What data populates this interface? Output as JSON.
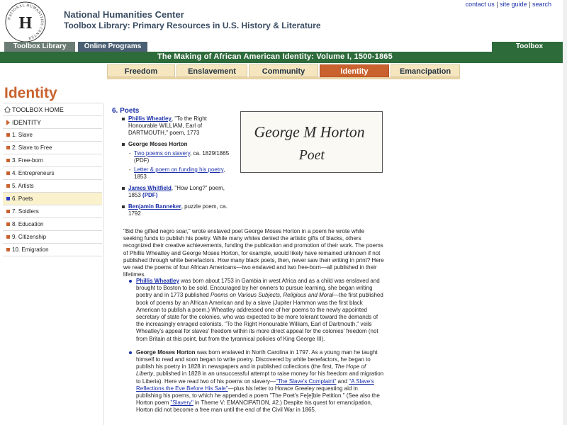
{
  "header": {
    "org_name": "National Humanities Center",
    "library_name": "Toolbox Library: Primary Resources in U.S. History & Literature",
    "logo_text": "NATIONAL HUMANITIES CENTER",
    "logo_letter": "H",
    "links": [
      "contact us",
      "site guide",
      "search"
    ],
    "link_sep": "|"
  },
  "nav": {
    "tab_toolbox_library": "Toolbox Library",
    "tab_online_programs": "Online Programs",
    "tab_toolbox": "Toolbox",
    "banner_title": "The Making of African American Identity: Volume I, 1500-1865",
    "theme_tabs": [
      "Freedom",
      "Enslavement",
      "Community",
      "Identity",
      "Emancipation"
    ],
    "active_theme": "Identity"
  },
  "page_title": "Identity",
  "sidebar": {
    "home": "TOOLBOX HOME",
    "current": "IDENTITY",
    "items": [
      "1. Slave",
      "2. Slave to Free",
      "3. Free-born",
      "4. Entrepreneurs",
      "5. Artists",
      "6. Poets",
      "7. Soldiers",
      "8. Education",
      "9. Citizenship",
      "10. Emigration"
    ],
    "active_item": "6. Poets"
  },
  "section": {
    "heading": "6.  Poets",
    "r1_link": "Phillis Wheatley",
    "r1_text": ", \"To the Right Honourable WILLIAM, Earl of DARTMOUTH,\" poem, 1773",
    "r2_name": "George Moses Horton",
    "r2_sub1_link": "Two poems on slavery",
    "r2_sub1_text": ", ca. 1829/1865",
    "r2_sub2_link": "Letter & poem on funding his poetry",
    "r2_sub2_text": ", 1853",
    "pdf": "(PDF)",
    "r3_link": "James Whitfield",
    "r3_text": ", \"How Long?\" poem, 1853",
    "r4_link": "Benjamin Banneker",
    "r4_text": ", puzzle poem, ca. 1792",
    "signature_line1": "George M Horton",
    "signature_line2": "Poet"
  },
  "intro": "\"Bid the gifted negro soar,\" wrote enslaved poet George Moses Horton in a poem he wrote while seeking funds to publish his poetry. While many whites denied the artistic gifts of blacks, others recognized their creative achievements, funding the publication and promotion of their work. The poems of Phillis Wheatley and George Moses Horton, for example, would likely have remained unknown if not published through white benefactors. How many black poets, then, never saw their writing in print? Here we read the poems of four African Americans—two enslaved and two free-born—all published in their lifetimes.",
  "bios": {
    "wheatley_name": "Phillis Wheatley",
    "wheatley_a": " was born about 1753 in Gambia in west Africa and as a child was enslaved and brought to Boston to be sold. Encouraged by her owners to pursue learning, she began writing poetry and in 1773 published ",
    "wheatley_book": "Poems on Various Subjects, Religious and Moral",
    "wheatley_b": "—the first published book of poems by an African American and by a slave (Jupiter Hammon was the first black American to publish a poem.) Wheatley addressed one of her poems to the newly appointed secretary of state for the colonies, who was expected to be more tolerant toward the demands of the increasingly enraged colonists. \"To the Right Honourable William, Earl of Dartmouth,\" veils Wheatley's appeal for slaves' freedom within its more direct appeal for the colonies' freedom (not from Britain at this point, but from the tyrannical policies of King George III).",
    "horton_name": "George Moses Horton",
    "horton_a": " was born enslaved in North Carolina in 1797. As a young man he taught himself to read and soon began to write poetry. Discovered by white benefactors, he began to publish his poetry in 1828 in newspapers and in published collections (the first, ",
    "horton_book": "The Hope of Liberty",
    "horton_b": ", published in 1828 in an unsuccessful attempt to raise money for his freedom and migration to Liberia). Here we read two of his poems on slavery—",
    "horton_link1": "\"The Slave's Complaint\"",
    "horton_and": " and ",
    "horton_link2": "\"A Slave's Reflections the Eve Before His Sale\"",
    "horton_c": "—plus his letter to Horace Greeley requesting aid in publishing his poems, to which he appended a poem \"The Poet's Fe[e]ble Petition.\" (See also the Horton poem ",
    "horton_link3": "\"Slavery\"",
    "horton_d": " in Theme V: EMANCIPATION, #2.) Despite his quest for emancipation, Horton did not become a free man until the end of the Civil War in 1865."
  },
  "colors": {
    "accent_orange": "#c9622e",
    "green_bar": "#2e6b3b",
    "link_blue": "#1a2fa8",
    "tab_bg": "#f6e6bf"
  }
}
